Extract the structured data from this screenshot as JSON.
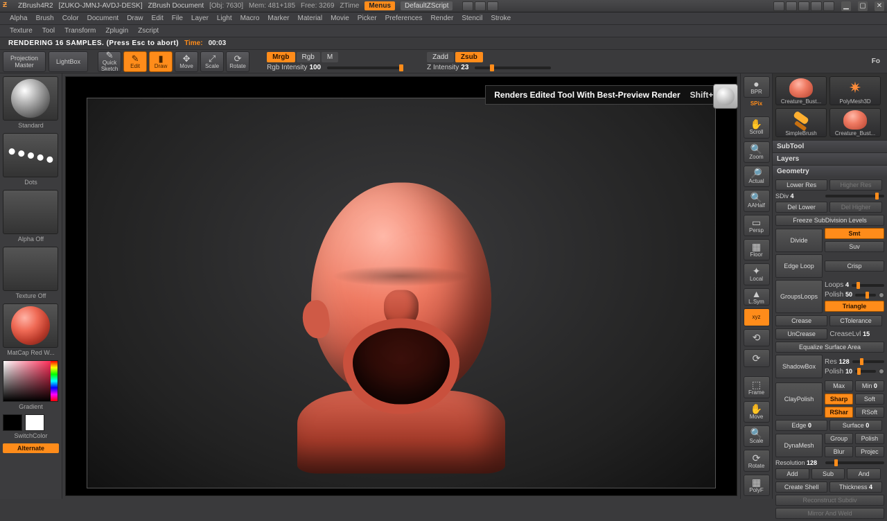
{
  "titlebar": {
    "app": "ZBrush4R2",
    "host": "[ZUKO-JMNJ-AVDJ-DESK]",
    "doc": "ZBrush Document",
    "obj": "[Obj: 7630]",
    "mem": "Mem: 481+185",
    "free": "Free: 3269",
    "ztime": "ZTime",
    "menus_btn": "Menus",
    "script_btn": "DefaultZScript"
  },
  "menu1": [
    "Alpha",
    "Brush",
    "Color",
    "Document",
    "Draw",
    "Edit",
    "File",
    "Layer",
    "Light",
    "Macro",
    "Marker",
    "Material",
    "Movie",
    "Picker",
    "Preferences",
    "Render",
    "Stencil",
    "Stroke"
  ],
  "menu2": [
    "Texture",
    "Tool",
    "Transform",
    "Zplugin",
    "Zscript"
  ],
  "status": {
    "msg": "RENDERING 16 SAMPLES. (Press Esc to abort)",
    "time_label": "Time:",
    "time_val": "00:03"
  },
  "shelf": {
    "proj_master_l1": "Projection",
    "proj_master_l2": "Master",
    "lightbox": "LightBox",
    "quicksketch_l1": "Quick",
    "quicksketch_l2": "Sketch",
    "edit": "Edit",
    "draw": "Draw",
    "move": "Move",
    "scale": "Scale",
    "rotate": "Rotate",
    "mrgb": "Mrgb",
    "rgb": "Rgb",
    "m": "M",
    "rgb_int_label": "Rgb Intensity",
    "rgb_int_val": "100",
    "zadd": "Zadd",
    "zsub": "Zsub",
    "zint_label": "Z Intensity",
    "zint_val": "23",
    "fo": "Fo"
  },
  "left": {
    "brush": "Standard",
    "stroke": "Dots",
    "alpha": "Alpha Off",
    "texture": "Texture Off",
    "material": "MatCap Red W...",
    "gradient": "Gradient",
    "switch": "SwitchColor",
    "alternate": "Alternate"
  },
  "tooltip": {
    "text": "Renders Edited Tool With Best-Preview Render",
    "shortcut": "Shift+R"
  },
  "gutter": {
    "bpr": "BPR",
    "spix": "SPix",
    "scroll": "Scroll",
    "zoom": "Zoom",
    "actual": "Actual",
    "aahalf": "AAHalf",
    "persp": "Persp",
    "floor": "Floor",
    "local": "Local",
    "lsym": "L.Sym",
    "xyz": "xyz",
    "frame": "Frame",
    "move": "Move",
    "scale": "Scale",
    "rotate": "Rotate",
    "polyf": "PolyF"
  },
  "thumbs": {
    "t1": "Creature_Bust...",
    "t2": "PolyMesh3D",
    "t3": "SimpleBrush",
    "t4": "Creature_Bust..."
  },
  "right": {
    "subtool": "SubTool",
    "layers": "Layers",
    "geometry": "Geometry",
    "lower_res": "Lower Res",
    "higher_res": "Higher Res",
    "sdiv_label": "SDiv",
    "sdiv_val": "4",
    "del_lower": "Del Lower",
    "del_higher": "Del Higher",
    "freeze": "Freeze SubDivision Levels",
    "divide": "Divide",
    "smt": "Smt",
    "suv": "Suv",
    "edgeloop": "Edge Loop",
    "crisp": "Crisp",
    "groupsloops": "GroupsLoops",
    "loops_label": "Loops",
    "loops_val": "4",
    "polish_label": "Polish",
    "polish_val": "50",
    "triangle": "Triangle",
    "crease": "Crease",
    "uncrease": "UnCrease",
    "ctol": "CTolerance",
    "creaselvl_label": "CreaseLvl",
    "creaselvl_val": "15",
    "equalize": "Equalize Surface Area",
    "shadowbox": "ShadowBox",
    "res_label": "Res",
    "res_val": "128",
    "polish2_label": "Polish",
    "polish2_val": "10",
    "claypolish": "ClayPolish",
    "max": "Max",
    "min_label": "Min",
    "min_val": "0",
    "sharp": "Sharp",
    "soft": "Soft",
    "rsharp": "RShar",
    "rsoft": "RSoft",
    "edge_label": "Edge",
    "edge_val": "0",
    "surface_label": "Surface",
    "surface_val": "0",
    "dynamesh": "DynaMesh",
    "group": "Group",
    "polish_d": "Polish",
    "blur": "Blur",
    "project": "Projec",
    "resolution_label": "Resolution",
    "resolution_val": "128",
    "add": "Add",
    "sub": "Sub",
    "and": "And",
    "create_shell": "Create Shell",
    "thickness_label": "Thickness",
    "thickness_val": "4",
    "reconstruct": "Reconstruct Subdiv",
    "mirror": "Mirror And Weld"
  }
}
